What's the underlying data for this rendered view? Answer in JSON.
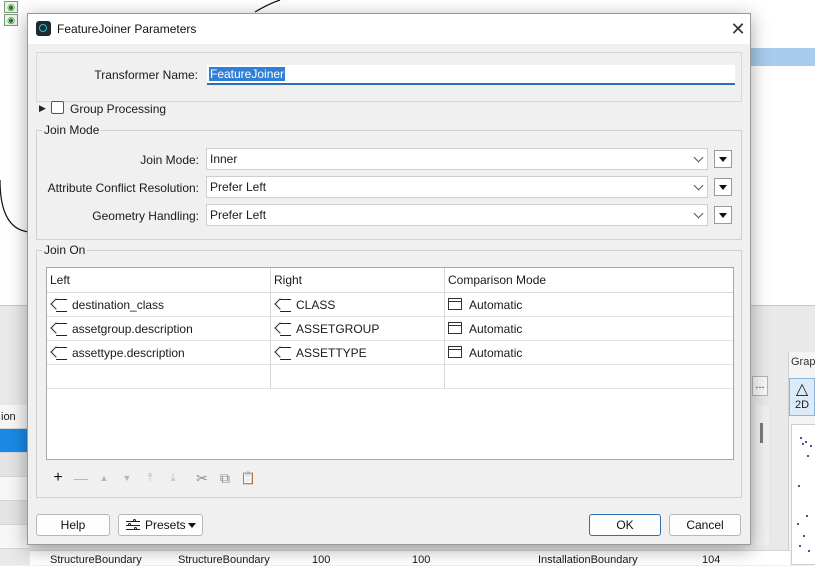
{
  "dialog": {
    "title": "FeatureJoiner Parameters",
    "close_glyph": "✕",
    "transformer_name_label": "Transformer Name:",
    "transformer_name_value": "FeatureJoiner",
    "group_processing_label": "Group Processing",
    "group_processing_checked": false,
    "join_mode_section": {
      "title": "Join Mode",
      "fields": [
        {
          "label": "Join Mode:",
          "value": "Inner"
        },
        {
          "label": "Attribute Conflict Resolution:",
          "value": "Prefer Left"
        },
        {
          "label": "Geometry Handling:",
          "value": "Prefer Left"
        }
      ]
    },
    "join_on_section": {
      "title": "Join On",
      "columns": [
        "Left",
        "Right",
        "Comparison Mode"
      ],
      "rows": [
        {
          "left": "destination_class",
          "right": "CLASS",
          "mode": "Automatic"
        },
        {
          "left": "assetgroup.description",
          "right": "ASSETGROUP",
          "mode": "Automatic"
        },
        {
          "left": "assettype.description",
          "right": "ASSETTYPE",
          "mode": "Automatic"
        }
      ]
    },
    "toolbar": {
      "add": "+",
      "remove": "—",
      "move_up": "▲",
      "move_down": "▼",
      "move_top": "⤒",
      "move_bottom": "⤓",
      "cut": "✂",
      "copy": "⧉",
      "paste": "📋"
    },
    "buttons": {
      "help": "Help",
      "presets": "Presets",
      "ok": "OK",
      "cancel": "Cancel"
    }
  },
  "background": {
    "left_list_partial": "ion",
    "graph_panel_title": "Grap",
    "graph_2d_label": "2D",
    "ellipsis": "...",
    "bottom_row": [
      "StructureBoundary",
      "StructureBoundary",
      "100",
      "100",
      "InstallationBoundary",
      "104"
    ]
  }
}
